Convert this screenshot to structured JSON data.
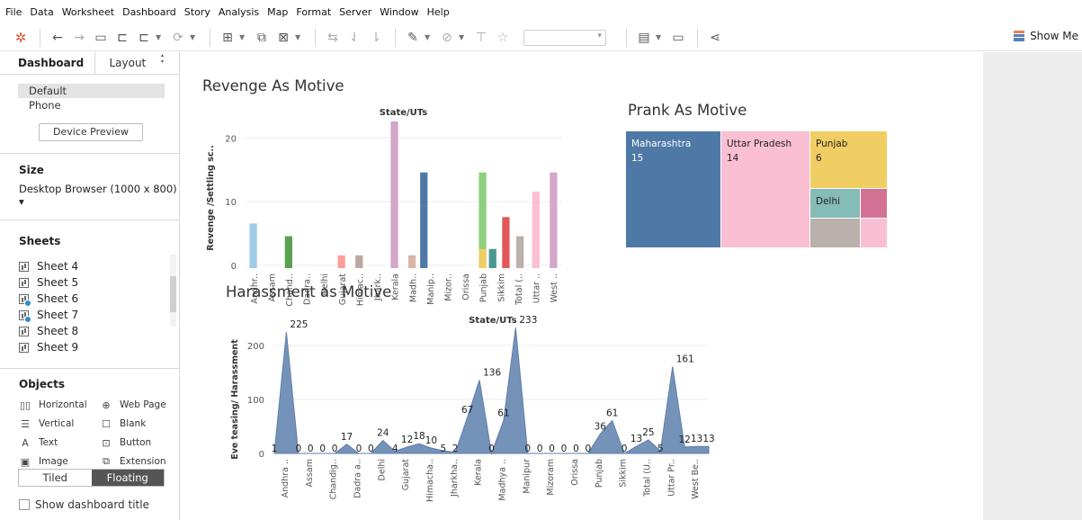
{
  "menu": [
    "File",
    "Data",
    "Worksheet",
    "Dashboard",
    "Story",
    "Analysis",
    "Map",
    "Format",
    "Server",
    "Window",
    "Help"
  ],
  "toolbar": {
    "show_me_label": "Show Me",
    "icons": [
      "tableau-logo-icon",
      "undo-icon",
      "redo-icon",
      "save-icon",
      "new-data-source-icon",
      "pause-updates-icon",
      "refresh-icon",
      "new-worksheet-icon",
      "duplicate-sheet-icon",
      "clear-sheet-icon",
      "swap-icon",
      "sort-ascending-icon",
      "sort-descending-icon",
      "highlight-icon",
      "group-icon",
      "labels-icon",
      "pin-icon",
      "fit-icon",
      "presentation-icon",
      "share-icon"
    ]
  },
  "left_pane": {
    "tabs": [
      "Dashboard",
      "Layout"
    ],
    "devices": [
      "Default",
      "Phone"
    ],
    "device_preview_label": "Device Preview",
    "size_title": "Size",
    "size_value": "Desktop Browser (1000 x 800) ▾",
    "sheets_title": "Sheets",
    "sheets": [
      {
        "name": "Sheet 4",
        "used": false
      },
      {
        "name": "Sheet 5",
        "used": false
      },
      {
        "name": "Sheet 6",
        "used": true
      },
      {
        "name": "Sheet 7",
        "used": true
      },
      {
        "name": "Sheet 8",
        "used": false
      },
      {
        "name": "Sheet 9",
        "used": false
      }
    ],
    "objects_title": "Objects",
    "objects": [
      {
        "label": "Horizontal",
        "icon": "horizontal-container-icon",
        "glyph": "▯▯"
      },
      {
        "label": "Web Page",
        "icon": "globe-icon",
        "glyph": "⊕"
      },
      {
        "label": "Vertical",
        "icon": "vertical-container-icon",
        "glyph": "☰"
      },
      {
        "label": "Blank",
        "icon": "blank-icon",
        "glyph": "☐"
      },
      {
        "label": "Text",
        "icon": "text-icon",
        "glyph": "A"
      },
      {
        "label": "Button",
        "icon": "button-icon",
        "glyph": "⊡"
      },
      {
        "label": "Image",
        "icon": "image-icon",
        "glyph": "▣"
      },
      {
        "label": "Extension",
        "icon": "extension-icon",
        "glyph": "⧉"
      }
    ],
    "layout_modes": [
      "Tiled",
      "Floating"
    ],
    "active_layout_mode": "Floating",
    "show_title_label": "Show dashboard title"
  },
  "colors": {
    "harassment_area": "#7592b9",
    "selected_bg": "#e3e3e3"
  },
  "chart_data": [
    {
      "type": "bar",
      "title": "Revenge As Motive",
      "header": "State/UTs",
      "ylabel": "Revenge /Settling sc..",
      "ylim": [
        0,
        23
      ],
      "yticks": [
        0,
        10,
        20
      ],
      "categories": [
        "Andhr..",
        "Assam",
        "Chand..",
        "Dadra..",
        "Delhi",
        "Gujarat",
        "Himac..",
        "Jhark..",
        "Kerala",
        "Madh..",
        "Manip..",
        "Mizor..",
        "Orissa",
        "Punjab",
        "Sikkim",
        "Total (..",
        "Uttar ..",
        "West .."
      ],
      "values": [
        7,
        0,
        5,
        0,
        0,
        2,
        2,
        0,
        23,
        2,
        15,
        0,
        15,
        3,
        3,
        8,
        5,
        12,
        15
      ],
      "bars": [
        {
          "category": "Andhr..",
          "value": 7,
          "color": "#a0cbe8"
        },
        {
          "category": "Assam",
          "value": 0,
          "color": "#f28e2b"
        },
        {
          "category": "Chand..",
          "value": 5,
          "color": "#59a14f"
        },
        {
          "category": "Dadra..",
          "value": 0,
          "color": "#8cd17d"
        },
        {
          "category": "Delhi",
          "value": 0,
          "color": "#b6992d"
        },
        {
          "category": "Gujarat",
          "value": 2,
          "color": "#ff9d9a"
        },
        {
          "category": "Himac..",
          "value": 2,
          "color": "#b8a8a0"
        },
        {
          "category": "Jhark..",
          "value": 0,
          "color": "#d4a6c8"
        },
        {
          "category": "Kerala",
          "value": 23,
          "color": "#d4a6c8"
        },
        {
          "category": "Madh..",
          "value": 2,
          "color": "#d7b5a6"
        },
        {
          "category": "Madh..",
          "value": 15,
          "color": "#4e79a7"
        },
        {
          "category": "Manip..",
          "value": 0,
          "color": "#f1ce63"
        },
        {
          "category": "Mizor..",
          "value": 0,
          "color": "#86bcb6"
        },
        {
          "category": "Orissa",
          "value": 15,
          "color": "#8cd17d"
        },
        {
          "category": "Punjab",
          "value": 3,
          "color": "#f1ce63"
        },
        {
          "category": "Punjab",
          "value": 3,
          "color": "#499894"
        },
        {
          "category": "Sikkim",
          "value": 8,
          "color": "#e15759"
        },
        {
          "category": "Total (..",
          "value": 5,
          "color": "#bab0ac"
        },
        {
          "category": "Uttar ..",
          "value": 12,
          "color": "#fabfd2"
        },
        {
          "category": "West ..",
          "value": 15,
          "color": "#d4a6c8"
        }
      ]
    },
    {
      "type": "treemap",
      "title": "Prank As Motive",
      "cells": [
        {
          "label": "Maharashtra",
          "value": 15,
          "color": "#4e79a7",
          "show_value": true
        },
        {
          "label": "Uttar Pradesh",
          "value": 14,
          "color": "#fabfd2",
          "show_value": true
        },
        {
          "label": "Punjab",
          "value": 6,
          "color": "#f1ce63",
          "show_value": true
        },
        {
          "label": "Delhi",
          "value": null,
          "color": "#86bcb6",
          "show_value": false
        },
        {
          "label": "",
          "value": null,
          "color": "#d37295",
          "show_value": false
        },
        {
          "label": "",
          "value": null,
          "color": "#bab0ac",
          "show_value": false
        },
        {
          "label": "",
          "value": null,
          "color": "#fabfd2",
          "show_value": false
        }
      ]
    },
    {
      "type": "area",
      "title": "Harassment as Motive",
      "header": "State/UTs",
      "ylabel": "Eve teasing/ Harassment",
      "ylim": [
        0,
        250
      ],
      "yticks": [
        0,
        100,
        200
      ],
      "categories": [
        "Andhra ..",
        "Assam",
        "Chandig..",
        "Dadra a..",
        "Delhi",
        "Gujarat",
        "Himacha..",
        "Jharkha..",
        "Kerala",
        "Madhya ..",
        "Manipur",
        "Mizoram",
        "Orissa",
        "Punjab",
        "Sikkim",
        "Total (U..",
        "Uttar Pr..",
        "West Be.."
      ],
      "points": [
        {
          "label": "1",
          "value": 1
        },
        {
          "label": "225",
          "value": 225
        },
        {
          "label": "0",
          "value": 0
        },
        {
          "label": "0",
          "value": 0
        },
        {
          "label": "0",
          "value": 0
        },
        {
          "label": "0",
          "value": 0
        },
        {
          "label": "17",
          "value": 17
        },
        {
          "label": "0",
          "value": 0
        },
        {
          "label": "0",
          "value": 0
        },
        {
          "label": "24",
          "value": 24
        },
        {
          "label": "4",
          "value": 4
        },
        {
          "label": "12",
          "value": 12
        },
        {
          "label": "18",
          "value": 18
        },
        {
          "label": "10",
          "value": 10
        },
        {
          "label": "5",
          "value": 5
        },
        {
          "label": "2",
          "value": 2
        },
        {
          "label": "67",
          "value": 67
        },
        {
          "label": "136",
          "value": 136
        },
        {
          "label": "0",
          "value": 0
        },
        {
          "label": "61",
          "value": 61
        },
        {
          "label": "233",
          "value": 233
        },
        {
          "label": "0",
          "value": 0
        },
        {
          "label": "0",
          "value": 0
        },
        {
          "label": "0",
          "value": 0
        },
        {
          "label": "0",
          "value": 0
        },
        {
          "label": "0",
          "value": 0
        },
        {
          "label": "0",
          "value": 0
        },
        {
          "label": "36",
          "value": 36
        },
        {
          "label": "61",
          "value": 61
        },
        {
          "label": "0",
          "value": 0
        },
        {
          "label": "13",
          "value": 13
        },
        {
          "label": "25",
          "value": 25
        },
        {
          "label": "5",
          "value": 5
        },
        {
          "label": "161",
          "value": 161
        },
        {
          "label": "12",
          "value": 12
        },
        {
          "label": "13",
          "value": 13
        },
        {
          "label": "13",
          "value": 13
        }
      ]
    }
  ]
}
